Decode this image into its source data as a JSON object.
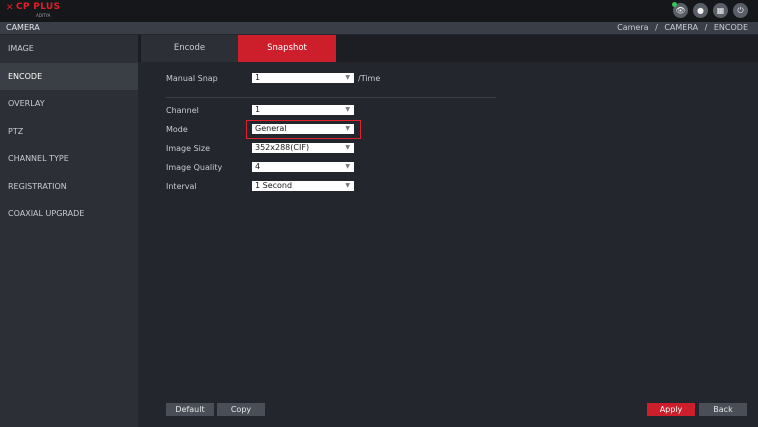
{
  "header": {
    "brand": "CP PLUS",
    "brand_sub": "ADITYA",
    "icons": [
      "eye-icon",
      "user-icon",
      "grid-icon",
      "power-icon"
    ],
    "status_color": "#35c45a"
  },
  "titlebar": {
    "title": "CAMERA",
    "breadcrumb": [
      "Camera",
      "CAMERA",
      "ENCODE"
    ],
    "separator": "/"
  },
  "sidebar": {
    "items": [
      {
        "label": "IMAGE",
        "active": false
      },
      {
        "label": "ENCODE",
        "active": true
      },
      {
        "label": "OVERLAY",
        "active": false
      },
      {
        "label": "PTZ",
        "active": false
      },
      {
        "label": "CHANNEL TYPE",
        "active": false
      },
      {
        "label": "REGISTRATION",
        "active": false
      },
      {
        "label": "COAXIAL UPGRADE",
        "active": false
      }
    ]
  },
  "tabs": [
    {
      "label": "Encode",
      "active": false
    },
    {
      "label": "Snapshot",
      "active": true
    }
  ],
  "form": {
    "manual_snap": {
      "label": "Manual Snap",
      "value": "1",
      "unit": "/Time"
    },
    "channel": {
      "label": "Channel",
      "value": "1"
    },
    "mode": {
      "label": "Mode",
      "value": "General"
    },
    "image_size": {
      "label": "Image Size",
      "value": "352x288(CIF)"
    },
    "image_quality": {
      "label": "Image Quality",
      "value": "4"
    },
    "interval": {
      "label": "Interval",
      "value": "1 Second"
    }
  },
  "buttons": {
    "default": "Default",
    "copy": "Copy",
    "apply": "Apply",
    "back": "Back"
  },
  "colors": {
    "accent": "#cc1f2b",
    "highlight": "#e0202a"
  }
}
